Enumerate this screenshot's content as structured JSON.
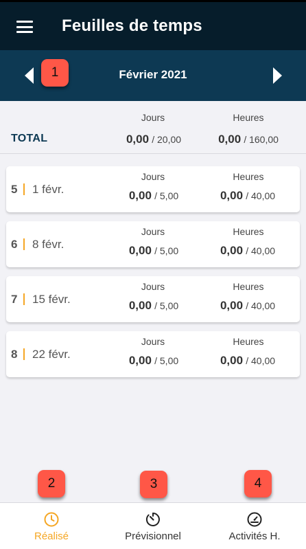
{
  "header": {
    "title": "Feuilles de temps"
  },
  "month": {
    "label": "Février 2021"
  },
  "badges": [
    "1",
    "2",
    "3",
    "4"
  ],
  "labels": {
    "jours": "Jours",
    "heures": "Heures"
  },
  "total": {
    "label": "TOTAL",
    "jours_value": "0,00",
    "jours_total": "/ 20,00",
    "heures_value": "0,00",
    "heures_total": "/ 160,00"
  },
  "weeks": [
    {
      "num": "5",
      "date": "1 févr.",
      "jours_value": "0,00",
      "jours_total": "/ 5,00",
      "heures_value": "0,00",
      "heures_total": "/ 40,00"
    },
    {
      "num": "6",
      "date": "8 févr.",
      "jours_value": "0,00",
      "jours_total": "/ 5,00",
      "heures_value": "0,00",
      "heures_total": "/ 40,00"
    },
    {
      "num": "7",
      "date": "15 févr.",
      "jours_value": "0,00",
      "jours_total": "/ 5,00",
      "heures_value": "0,00",
      "heures_total": "/ 40,00"
    },
    {
      "num": "8",
      "date": "22 févr.",
      "jours_value": "0,00",
      "jours_total": "/ 5,00",
      "heures_value": "0,00",
      "heures_total": "/ 40,00"
    }
  ],
  "nav": {
    "items": [
      {
        "label": "Réalisé",
        "icon": "clock-icon",
        "active": true
      },
      {
        "label": "Prévisionnel",
        "icon": "timer-icon",
        "active": false
      },
      {
        "label": "Activités H.",
        "icon": "speedometer-icon",
        "active": false
      }
    ]
  },
  "colors": {
    "header_bg": "#061d2b",
    "month_bg": "#0d3953",
    "accent": "#f5a623",
    "badge": "#ff5747"
  }
}
